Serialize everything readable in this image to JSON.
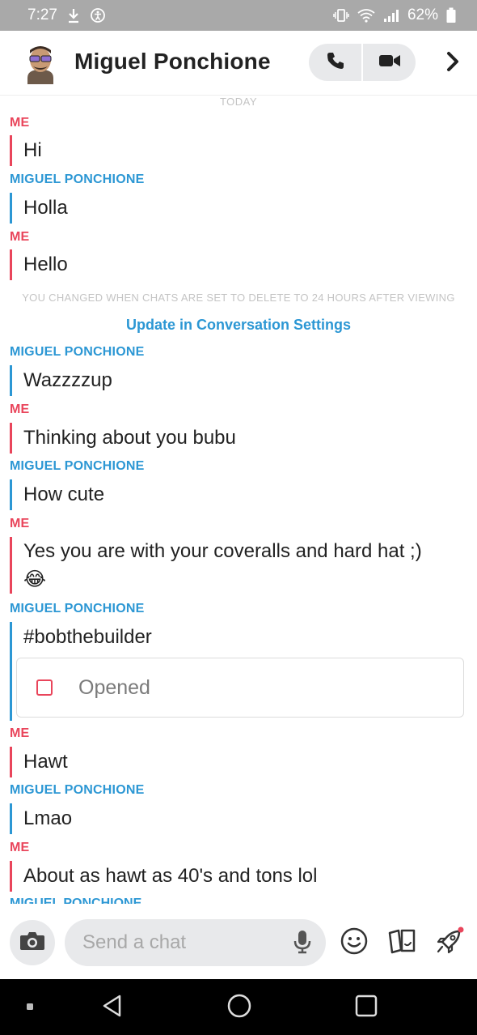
{
  "status_bar": {
    "time": "7:27",
    "battery": "62%"
  },
  "header": {
    "contact_name": "Miguel Ponchione"
  },
  "chat": {
    "date_label": "TODAY",
    "me_label": "ME",
    "contact_label": "MIGUEL PONCHIONE",
    "messages": [
      {
        "text": "Hi"
      },
      {
        "text": "Holla"
      },
      {
        "text": "Hello"
      },
      {
        "text": "Wazzzzup"
      },
      {
        "text": "Thinking about you bubu"
      },
      {
        "text": "How cute"
      },
      {
        "text": "Yes you are with your coveralls and hard hat ;)"
      },
      {
        "text": "😂"
      },
      {
        "text": "#bobthebuilder"
      },
      {
        "text": "Hawt"
      },
      {
        "text": "Lmao"
      },
      {
        "text": "About as hawt as 40's and tons lol"
      }
    ],
    "system_note": "YOU CHANGED WHEN CHATS ARE SET TO DELETE TO 24 HOURS AFTER VIEWING",
    "settings_link": "Update in Conversation Settings",
    "opened_label": "Opened"
  },
  "composer": {
    "placeholder": "Send a chat"
  },
  "colors": {
    "me": "#e9455b",
    "contact": "#2c97d4"
  }
}
